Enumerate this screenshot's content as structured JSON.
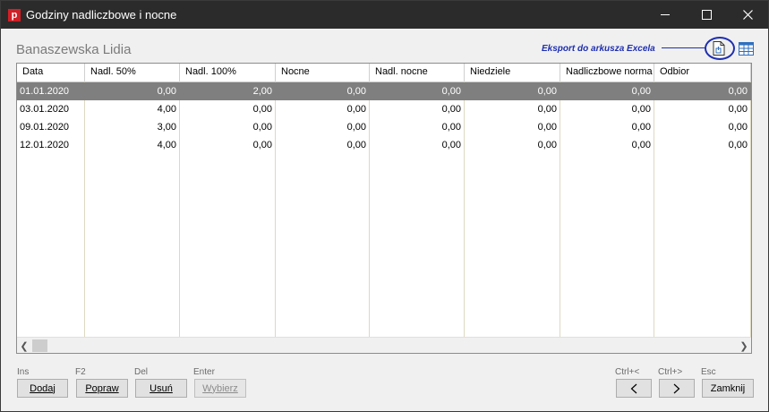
{
  "window": {
    "title": "Godziny nadliczbowe i nocne",
    "app_icon_letter": "p"
  },
  "header": {
    "person_name": "Banaszewska Lidia",
    "export_annotation": "Eksport do arkusza Excela"
  },
  "table": {
    "columns": [
      "Data",
      "Nadl. 50%",
      "Nadl. 100%",
      "Nocne",
      "Nadl. nocne",
      "Niedziele",
      "Nadliczbowe norma",
      "Odbior"
    ],
    "rows": [
      [
        "01.01.2020",
        "0,00",
        "2,00",
        "0,00",
        "0,00",
        "0,00",
        "0,00",
        "0,00"
      ],
      [
        "03.01.2020",
        "4,00",
        "0,00",
        "0,00",
        "0,00",
        "0,00",
        "0,00",
        "0,00"
      ],
      [
        "09.01.2020",
        "3,00",
        "0,00",
        "0,00",
        "0,00",
        "0,00",
        "0,00",
        "0,00"
      ],
      [
        "12.01.2020",
        "4,00",
        "0,00",
        "0,00",
        "0,00",
        "0,00",
        "0,00",
        "0,00"
      ]
    ],
    "selected_row": 0
  },
  "buttons": {
    "add": {
      "shortcut": "Ins",
      "label": "Dodaj"
    },
    "edit": {
      "shortcut": "F2",
      "label": "Popraw"
    },
    "delete": {
      "shortcut": "Del",
      "label": "Usuń"
    },
    "select": {
      "shortcut": "Enter",
      "label": "Wybierz"
    },
    "prev": {
      "shortcut": "Ctrl+<"
    },
    "next": {
      "shortcut": "Ctrl+>"
    },
    "close": {
      "shortcut": "Esc",
      "label": "Zamknij"
    }
  },
  "colors": {
    "annotation": "#1e2fb0",
    "app_icon": "#d11f26",
    "selected_row": "#7f7f7f"
  }
}
